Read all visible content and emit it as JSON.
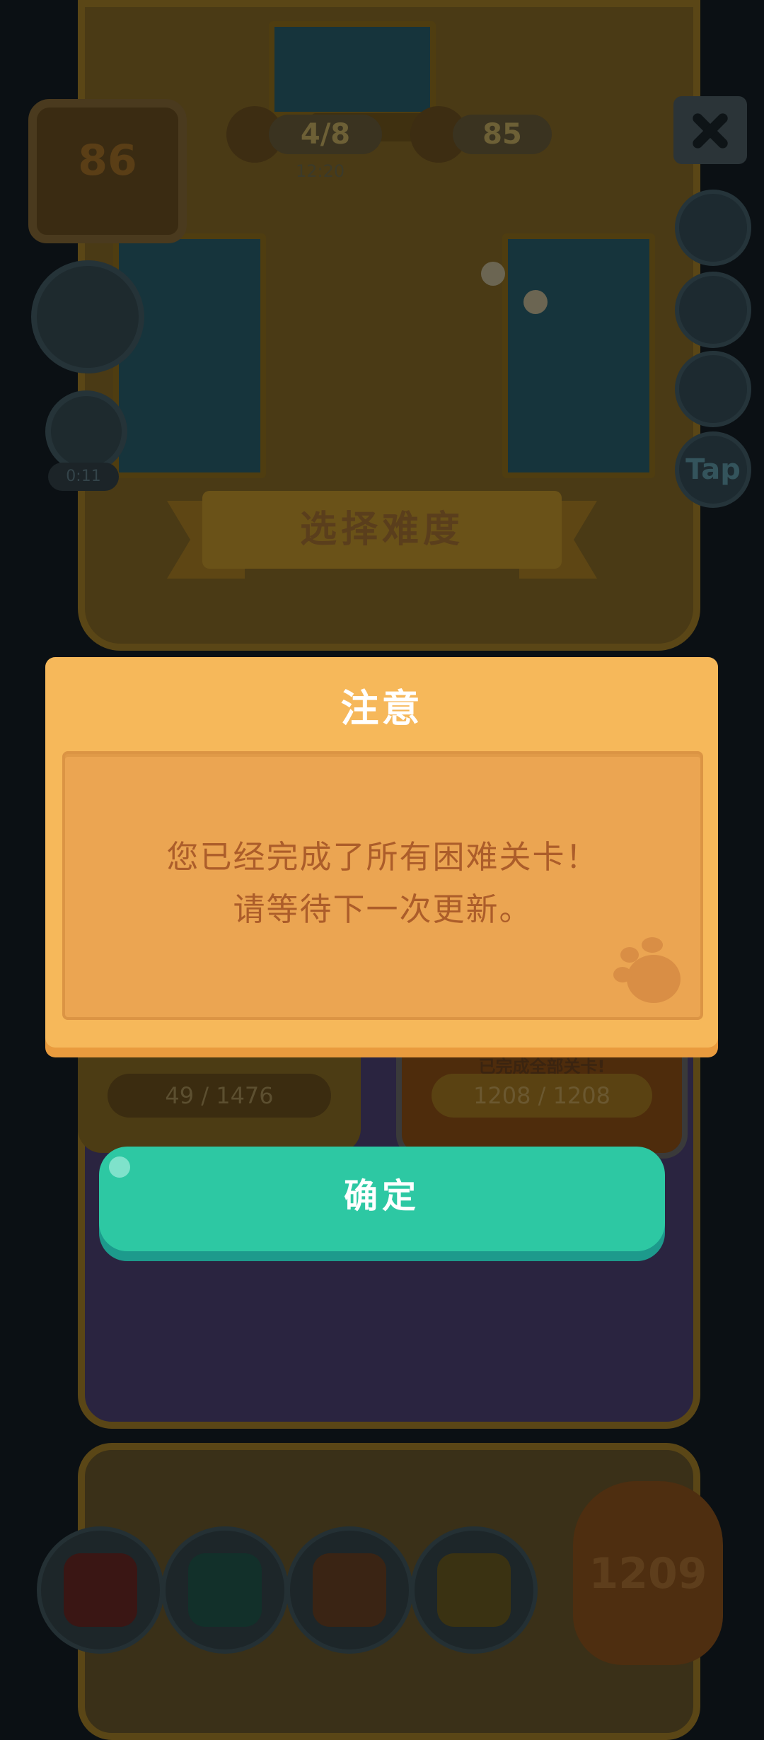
{
  "hud": {
    "house_level": "86",
    "task_progress": "4/8",
    "task_timer": "12:20",
    "coins": "85",
    "gift_timer": "0:11",
    "tap_label": "Tap"
  },
  "banner": {
    "title": "选择难度"
  },
  "cards": {
    "normal_progress": "49 / 1476",
    "hard_status": "已完成全部关卡!",
    "hard_progress": "1208 / 1208"
  },
  "dialog": {
    "title": "注意",
    "message_line1": "您已经完成了所有困难关卡！",
    "message_line2": "请等待下一次更新。",
    "confirm_label": "确定"
  },
  "bottom": {
    "current_level": "1209"
  },
  "colors": {
    "dialog_bg": "#f6b85a",
    "dialog_panel": "#eba552",
    "message_text": "#ac5d2a",
    "confirm_button": "#2dc8a3"
  },
  "icons": [
    "close-icon",
    "paw-icon",
    "gift-icon",
    "cushion-icon",
    "book-icon",
    "picture-icon",
    "lamp-icon"
  ]
}
